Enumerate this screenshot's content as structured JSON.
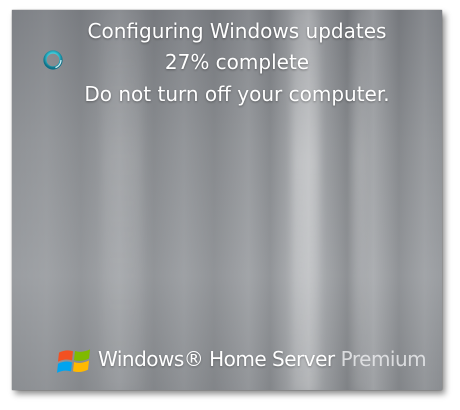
{
  "status": {
    "line1": "Configuring Windows updates",
    "line2": "27% complete",
    "line3": "Do not turn off your computer.",
    "progress_percent": 27
  },
  "branding": {
    "product": "Windows® Home Server",
    "edition": "Premium",
    "logo_icon": "windows-flag-icon"
  },
  "colors": {
    "background": "#8f9296",
    "text": "#ffffff",
    "spinner": "#35c6d6"
  }
}
